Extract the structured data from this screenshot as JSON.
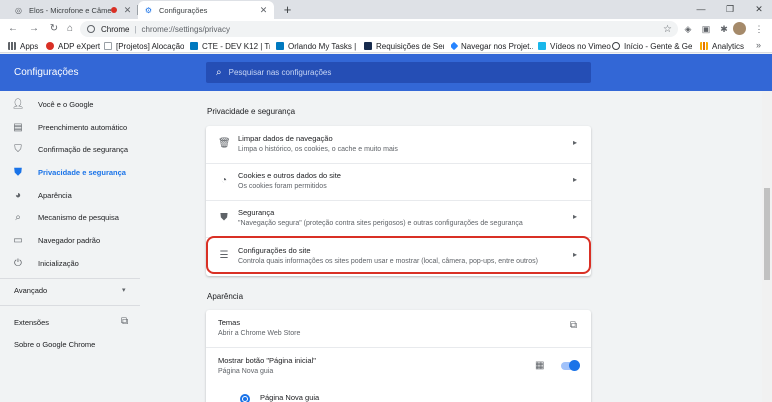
{
  "tabs": [
    {
      "title": "Elos - Microfone e Câmera",
      "recording": true
    },
    {
      "title": "Configurações"
    }
  ],
  "omnibox": {
    "scheme_label": "Chrome",
    "separator": "|",
    "url": "chrome://settings/privacy"
  },
  "bookmarks": [
    {
      "label": "Apps",
      "color": "#5f6368"
    },
    {
      "label": "ADP eXpert",
      "color": "#d93025"
    },
    {
      "label": "[Projetos] Alocação...",
      "color": "#e8eaed"
    },
    {
      "label": "CTE - DEV K12 | Trel...",
      "color": "#0079bf"
    },
    {
      "label": "Orlando My Tasks | ...",
      "color": "#0079bf"
    },
    {
      "label": "Requisições de Serv...",
      "color": "#172b4d"
    },
    {
      "label": "Navegar nos Projet...",
      "color": "#2684ff"
    },
    {
      "label": "Vídeos no Vimeo",
      "color": "#1ab7ea"
    },
    {
      "label": "Início - Gente & Ge...",
      "color": "#3c4043"
    },
    {
      "label": "Analytics",
      "color": "#f9ab00"
    }
  ],
  "header": {
    "title": "Configurações",
    "search_placeholder": "Pesquisar nas configurações"
  },
  "sidebar": {
    "items": [
      {
        "label": "Você e o Google",
        "icon": "person-icon"
      },
      {
        "label": "Preenchimento automático",
        "icon": "clipboard-icon"
      },
      {
        "label": "Confirmação de segurança",
        "icon": "shield-check-icon"
      },
      {
        "label": "Privacidade e segurança",
        "icon": "shield-icon",
        "selected": true
      },
      {
        "label": "Aparência",
        "icon": "palette-icon"
      },
      {
        "label": "Mecanismo de pesquisa",
        "icon": "search-icon"
      },
      {
        "label": "Navegador padrão",
        "icon": "browser-icon"
      },
      {
        "label": "Inicialização",
        "icon": "power-icon"
      }
    ],
    "advanced": "Avançado",
    "extensions": "Extensões",
    "about": "Sobre o Google Chrome"
  },
  "privacy": {
    "section_title": "Privacidade e segurança",
    "rows": [
      {
        "title": "Limpar dados de navegação",
        "subtitle": "Limpa o histórico, os cookies, o cache e muito mais",
        "icon": "trash-icon"
      },
      {
        "title": "Cookies e outros dados do site",
        "subtitle": "Os cookies foram permitidos",
        "icon": "cookie-icon"
      },
      {
        "title": "Segurança",
        "subtitle": "\"Navegação segura\" (proteção contra sites perigosos) e outras configurações de segurança",
        "icon": "shield-icon"
      },
      {
        "title": "Configurações do site",
        "subtitle": "Controla quais informações os sites podem usar e mostrar (local, câmera, pop-ups, entre outros)",
        "icon": "sliders-icon"
      }
    ]
  },
  "appearance": {
    "section_title": "Aparência",
    "themes_title": "Temas",
    "themes_sub": "Abrir a Chrome Web Store",
    "home_title": "Mostrar botão \"Página inicial\"",
    "home_sub": "Página Nova guia",
    "home_toggle_on": true,
    "radio_label": "Página Nova guia"
  }
}
